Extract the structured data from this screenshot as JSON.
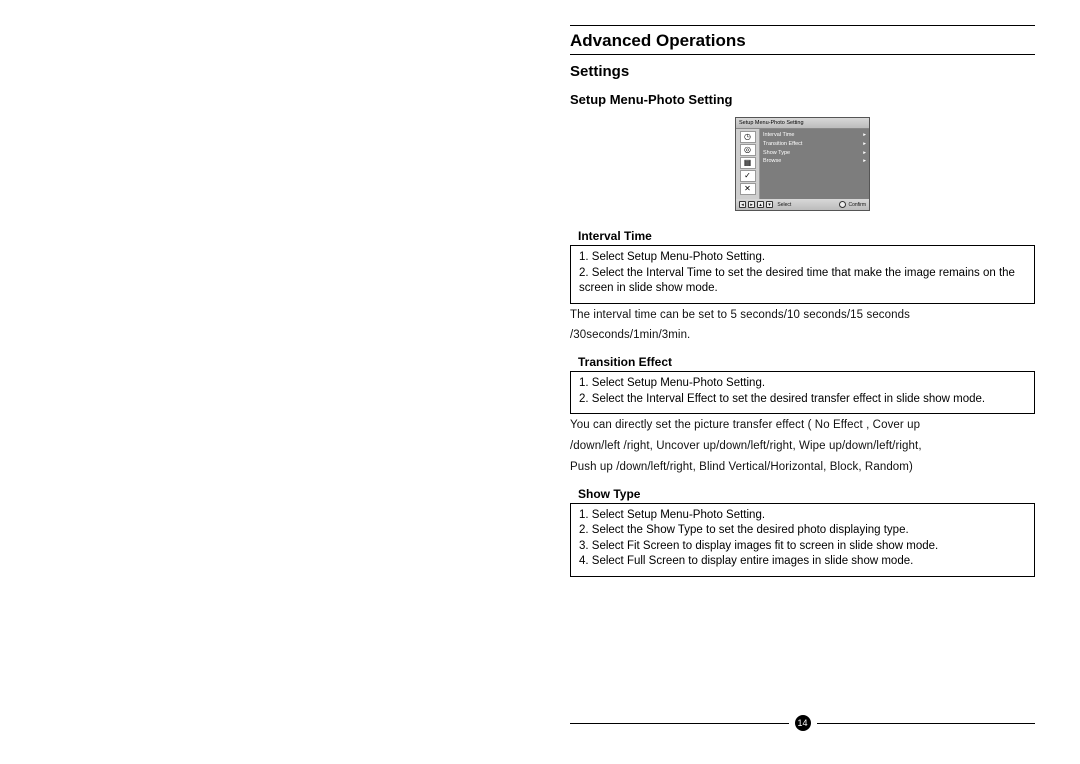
{
  "page_header": "Advanced Operations",
  "section_title": "Settings",
  "sub_title": "Setup Menu-Photo Setting",
  "menu": {
    "caption": "Setup Menu-Photo Setting",
    "items": [
      {
        "label": "Interval Time",
        "arrow": "▸"
      },
      {
        "label": "Transition Effect",
        "arrow": "▸"
      },
      {
        "label": "Show Type",
        "arrow": "▸"
      },
      {
        "label": "Browse",
        "arrow": "▸"
      }
    ],
    "footer_select": "Select",
    "footer_confirm": "Confirm"
  },
  "sections": {
    "interval": {
      "heading": "Interval Time",
      "step1": "1. Select Setup Menu-Photo Setting.",
      "step2": "2. Select the Interval Time to set the desired time that make the image remains on the screen in slide show mode.",
      "note1": "The interval time  can be set to 5 seconds/10 seconds/15 seconds",
      "note2": "/30seconds/1min/3min."
    },
    "transition": {
      "heading": "Transition Effect",
      "step1": "1. Select Setup Menu-Photo Setting.",
      "step2": "2. Select the Interval Effect to set the desired transfer effect in slide show mode.",
      "note1": "You can directly set the  picture  transfer  effect ( No Effect , Cover up",
      "note2": "/down/left /right,  Uncover up/down/left/right, Wipe up/down/left/right,",
      "note3": "Push up /down/left/right,  Blind Vertical/Horizontal, Block, Random)"
    },
    "showtype": {
      "heading": "Show Type",
      "step1": "1. Select Setup Menu-Photo Setting.",
      "step2": "2. Select the Show Type to set the desired photo displaying type.",
      "step3": "3. Select Fit Screen to display images fit to screen in slide show mode.",
      "step4": "4. Select Full Screen to display entire images in slide show mode."
    }
  },
  "page_number": "14"
}
